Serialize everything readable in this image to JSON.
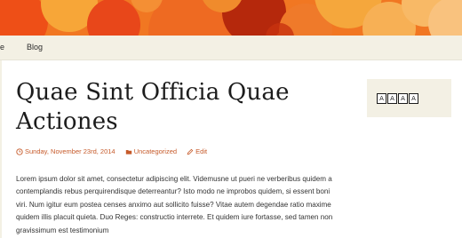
{
  "header": {
    "colors": {
      "deep_red": "#b5280c",
      "orange": "#ee5a1c",
      "amber": "#f39b2c",
      "light": "#f9c27e"
    }
  },
  "nav": {
    "items": [
      {
        "label": "e"
      },
      {
        "label": "Blog"
      }
    ]
  },
  "post": {
    "title": "Quae Sint Officia Quae Actiones",
    "date": "Sunday, November 23rd, 2014",
    "category": "Uncategorized",
    "edit_label": "Edit",
    "body": "Lorem ipsum dolor sit amet, consectetur adipiscing elit. Videmusne ut pueri ne verberibus quidem a contemplandis rebus perquirendisque deterreantur? Isto modo ne improbos quidem, si essent boni viri. Num igitur eum postea censes anximo aut sollicito fuisse? Vitae autem degendae ratio maxime quidem illis placuit quieta. Duo Reges: constructio interrete. Et quidem iure fortasse, sed tamen non gravissimum est testimonium"
  },
  "widget": {
    "chars": [
      "A",
      "A",
      "A",
      "A"
    ]
  },
  "icons": {
    "date": "clock-icon",
    "category": "folder-icon",
    "edit": "pencil-icon"
  },
  "accent": "#c65a2a"
}
